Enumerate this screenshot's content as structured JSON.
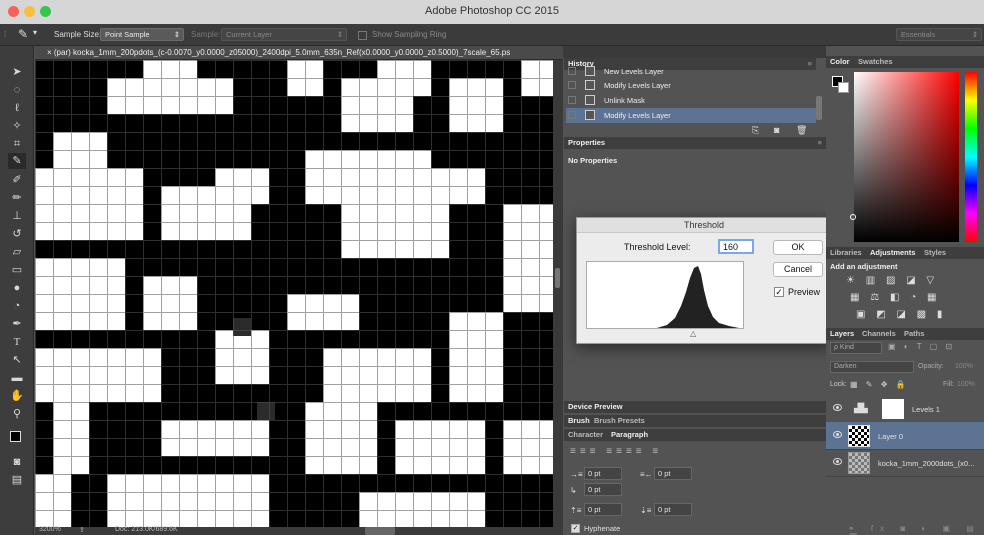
{
  "app": {
    "title": "Adobe Photoshop CC 2015"
  },
  "options": {
    "sample_size_label": "Sample Size:",
    "sample_size_value": "Point Sample",
    "sample_label": "Sample:",
    "sample_value": "Current Layer",
    "show_ring": "Show Sampling Ring",
    "workspace": "Essentials"
  },
  "document": {
    "tab_title": "× (par) kocka_1mm_200pdots_(c-0.0070_y0.0000_z05000)_2400dpi_5.0mm_635n_Ref(x0.0000_y0.0000_z0.5000)_7scale_65.ps",
    "zoom": "3200%",
    "doc_info": "Doc: 213.0K/689.6K"
  },
  "history": {
    "tab": "History",
    "items": [
      {
        "label": "New Levels Layer",
        "selected": false
      },
      {
        "label": "Modify Levels Layer",
        "selected": false
      },
      {
        "label": "Unlink Mask",
        "selected": false
      },
      {
        "label": "Modify Levels Layer",
        "selected": true
      }
    ]
  },
  "properties": {
    "tab": "Properties",
    "empty_text": "No Properties"
  },
  "threshold": {
    "title": "Threshold",
    "level_label": "Threshold Level:",
    "level_value": "160",
    "ok": "OK",
    "cancel": "Cancel",
    "preview_label": "Preview",
    "preview_checked": true
  },
  "lower_tabs": {
    "device_preview": "Device Preview",
    "brush": "Brush",
    "brush_presets": "Brush Presets",
    "character": "Character",
    "paragraph": "Paragraph"
  },
  "paragraph": {
    "indent_left": "0 pt",
    "indent_right": "0 pt",
    "first_line": "0 pt",
    "space_before": "0 pt",
    "space_after": "0 pt",
    "hyphenate": "Hyphenate"
  },
  "color_panel": {
    "tab_color": "Color",
    "tab_swatches": "Swatches"
  },
  "adjustments": {
    "tab_libraries": "Libraries",
    "tab_adjustments": "Adjustments",
    "tab_styles": "Styles",
    "add_label": "Add an adjustment"
  },
  "layers": {
    "tab_layers": "Layers",
    "tab_channels": "Channels",
    "tab_paths": "Paths",
    "kind_filter": "ρ Kind",
    "blend_mode": "Darken",
    "opacity_label": "Opacity:",
    "opacity_value": "100%",
    "lock_label": "Lock:",
    "fill_label": "Fill:",
    "fill_value": "100%",
    "items": [
      {
        "name": "Levels 1",
        "selected": false
      },
      {
        "name": "Layer 0",
        "selected": true
      },
      {
        "name": "kocka_1mm_2000dots_(x0...",
        "selected": false
      }
    ]
  },
  "colors": {
    "accent_selected": "#5d7394",
    "title_bar": "#d6d6d6",
    "panel_bg": "#535353"
  }
}
